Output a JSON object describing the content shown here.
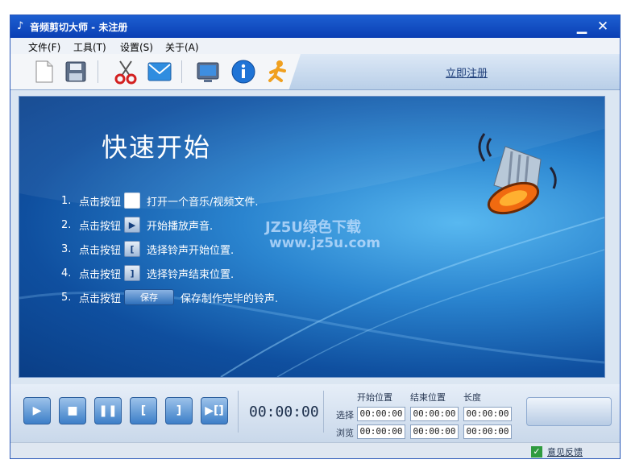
{
  "window": {
    "title": "音频剪切大师 - 未注册",
    "title_icon": "♪"
  },
  "menu": [
    "文件(F)",
    "工具(T)",
    "设置(S)",
    "关于(A)"
  ],
  "toolbar": {
    "buttons": [
      "new-file-icon",
      "save-icon",
      "cut-icon",
      "mail-icon",
      "screen-icon",
      "info-icon",
      "runner-icon"
    ],
    "register_label": "立即注册"
  },
  "main": {
    "title": "快速开始",
    "steps": [
      {
        "num": "1.",
        "pre": "点击按钮",
        "icon": "",
        "text": "打开一个音乐/视频文件."
      },
      {
        "num": "2.",
        "pre": "点击按钮",
        "icon": "▶",
        "text": "开始播放声音."
      },
      {
        "num": "3.",
        "pre": "点击按钮",
        "icon": "[",
        "text": "选择铃声开始位置."
      },
      {
        "num": "4.",
        "pre": "点击按钮",
        "icon": "]",
        "text": "选择铃声结束位置."
      },
      {
        "num": "5.",
        "pre": "点击按钮",
        "save_label": "保存",
        "text": "保存制作完毕的铃声."
      }
    ],
    "watermark": {
      "line1": "JZ5U绿色下载",
      "line2": "www.jz5u.com"
    }
  },
  "controls": {
    "time": "00:00:00",
    "headers": {
      "start": "开始位置",
      "end": "结束位置",
      "length": "长度"
    },
    "rows": {
      "select": {
        "label": "选择",
        "start": "00:00:00",
        "end": "00:00:00",
        "length": "00:00:00"
      },
      "browse": {
        "label": "浏览",
        "start": "00:00:00",
        "end": "00:00:00",
        "length": "00:00:00"
      }
    }
  },
  "status": {
    "feedback": "意见反馈"
  }
}
